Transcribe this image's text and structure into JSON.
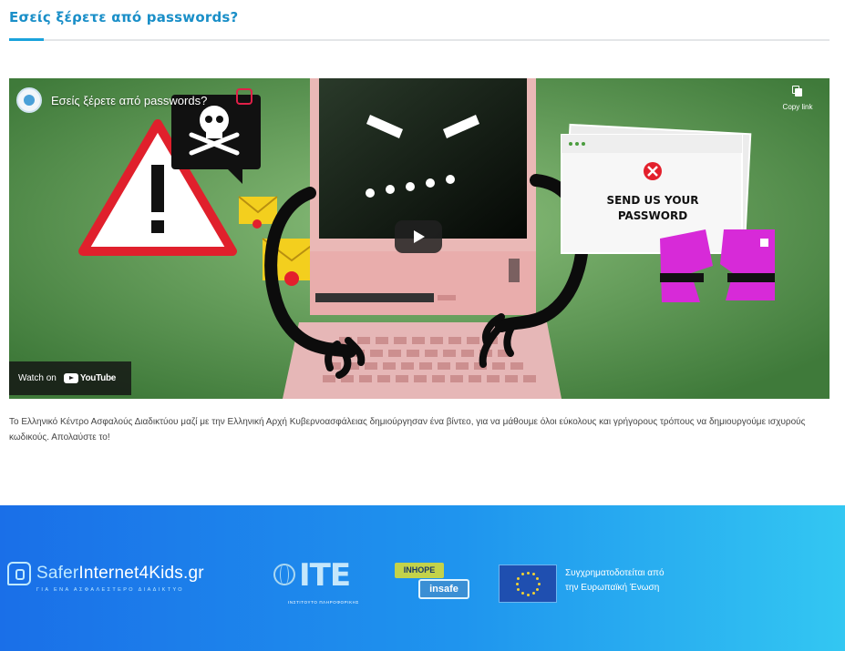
{
  "heading": {
    "title": "Εσείς ξέρετε από passwords?",
    "accent_color": "#1a8fc8"
  },
  "video": {
    "title": "Εσείς ξέρετε από passwords?",
    "copy_link_label": "Copy link",
    "watch_on_label": "Watch on",
    "platform_label": "YouTube",
    "popup_text_line1": "SEND US YOUR",
    "popup_text_line2": "PASSWORD",
    "icons": [
      "channel-avatar-icon",
      "copy-link-icon",
      "play-icon",
      "warning-icon",
      "skull-icon",
      "envelope-icon",
      "credit-card-icon"
    ]
  },
  "description": {
    "text": "Το Ελληνικό Κέντρο Ασφαλούς Διαδικτύου μαζί με την Ελληνική Αρχή Κυβερνοασφάλειας δημιούργησαν ένα βίντεο, για να μάθουμε όλοι εύκολους και γρήγορους τρόπους να δημιουργούμε ισχυρούς κωδικούς. Απολαύστε το!"
  },
  "footer": {
    "logo_prefix": "Safer",
    "logo_main": "Internet4Kids.gr",
    "logo_tagline": "ΓΙΑ ΕΝΑ ΑΣΦΑΛΕΣΤΕΡΟ ΔΙΑΔΙΚΤΥΟ",
    "ite_mark": "ΙΤΕ",
    "ite_subtitle": "ΙΝΣΤΙΤΟΥΤΟ ΠΛΗΡΟΦΟΡΙΚΗΣ",
    "insafe_top": "INHOPE",
    "insafe_bottom": "insafe",
    "eu_funding_line1": "Συγχρηματοδοτείται από",
    "eu_funding_line2": "την Ευρωπαϊκή Ένωση",
    "gradient_start": "#1a6fe8",
    "gradient_end": "#33c7f2"
  }
}
